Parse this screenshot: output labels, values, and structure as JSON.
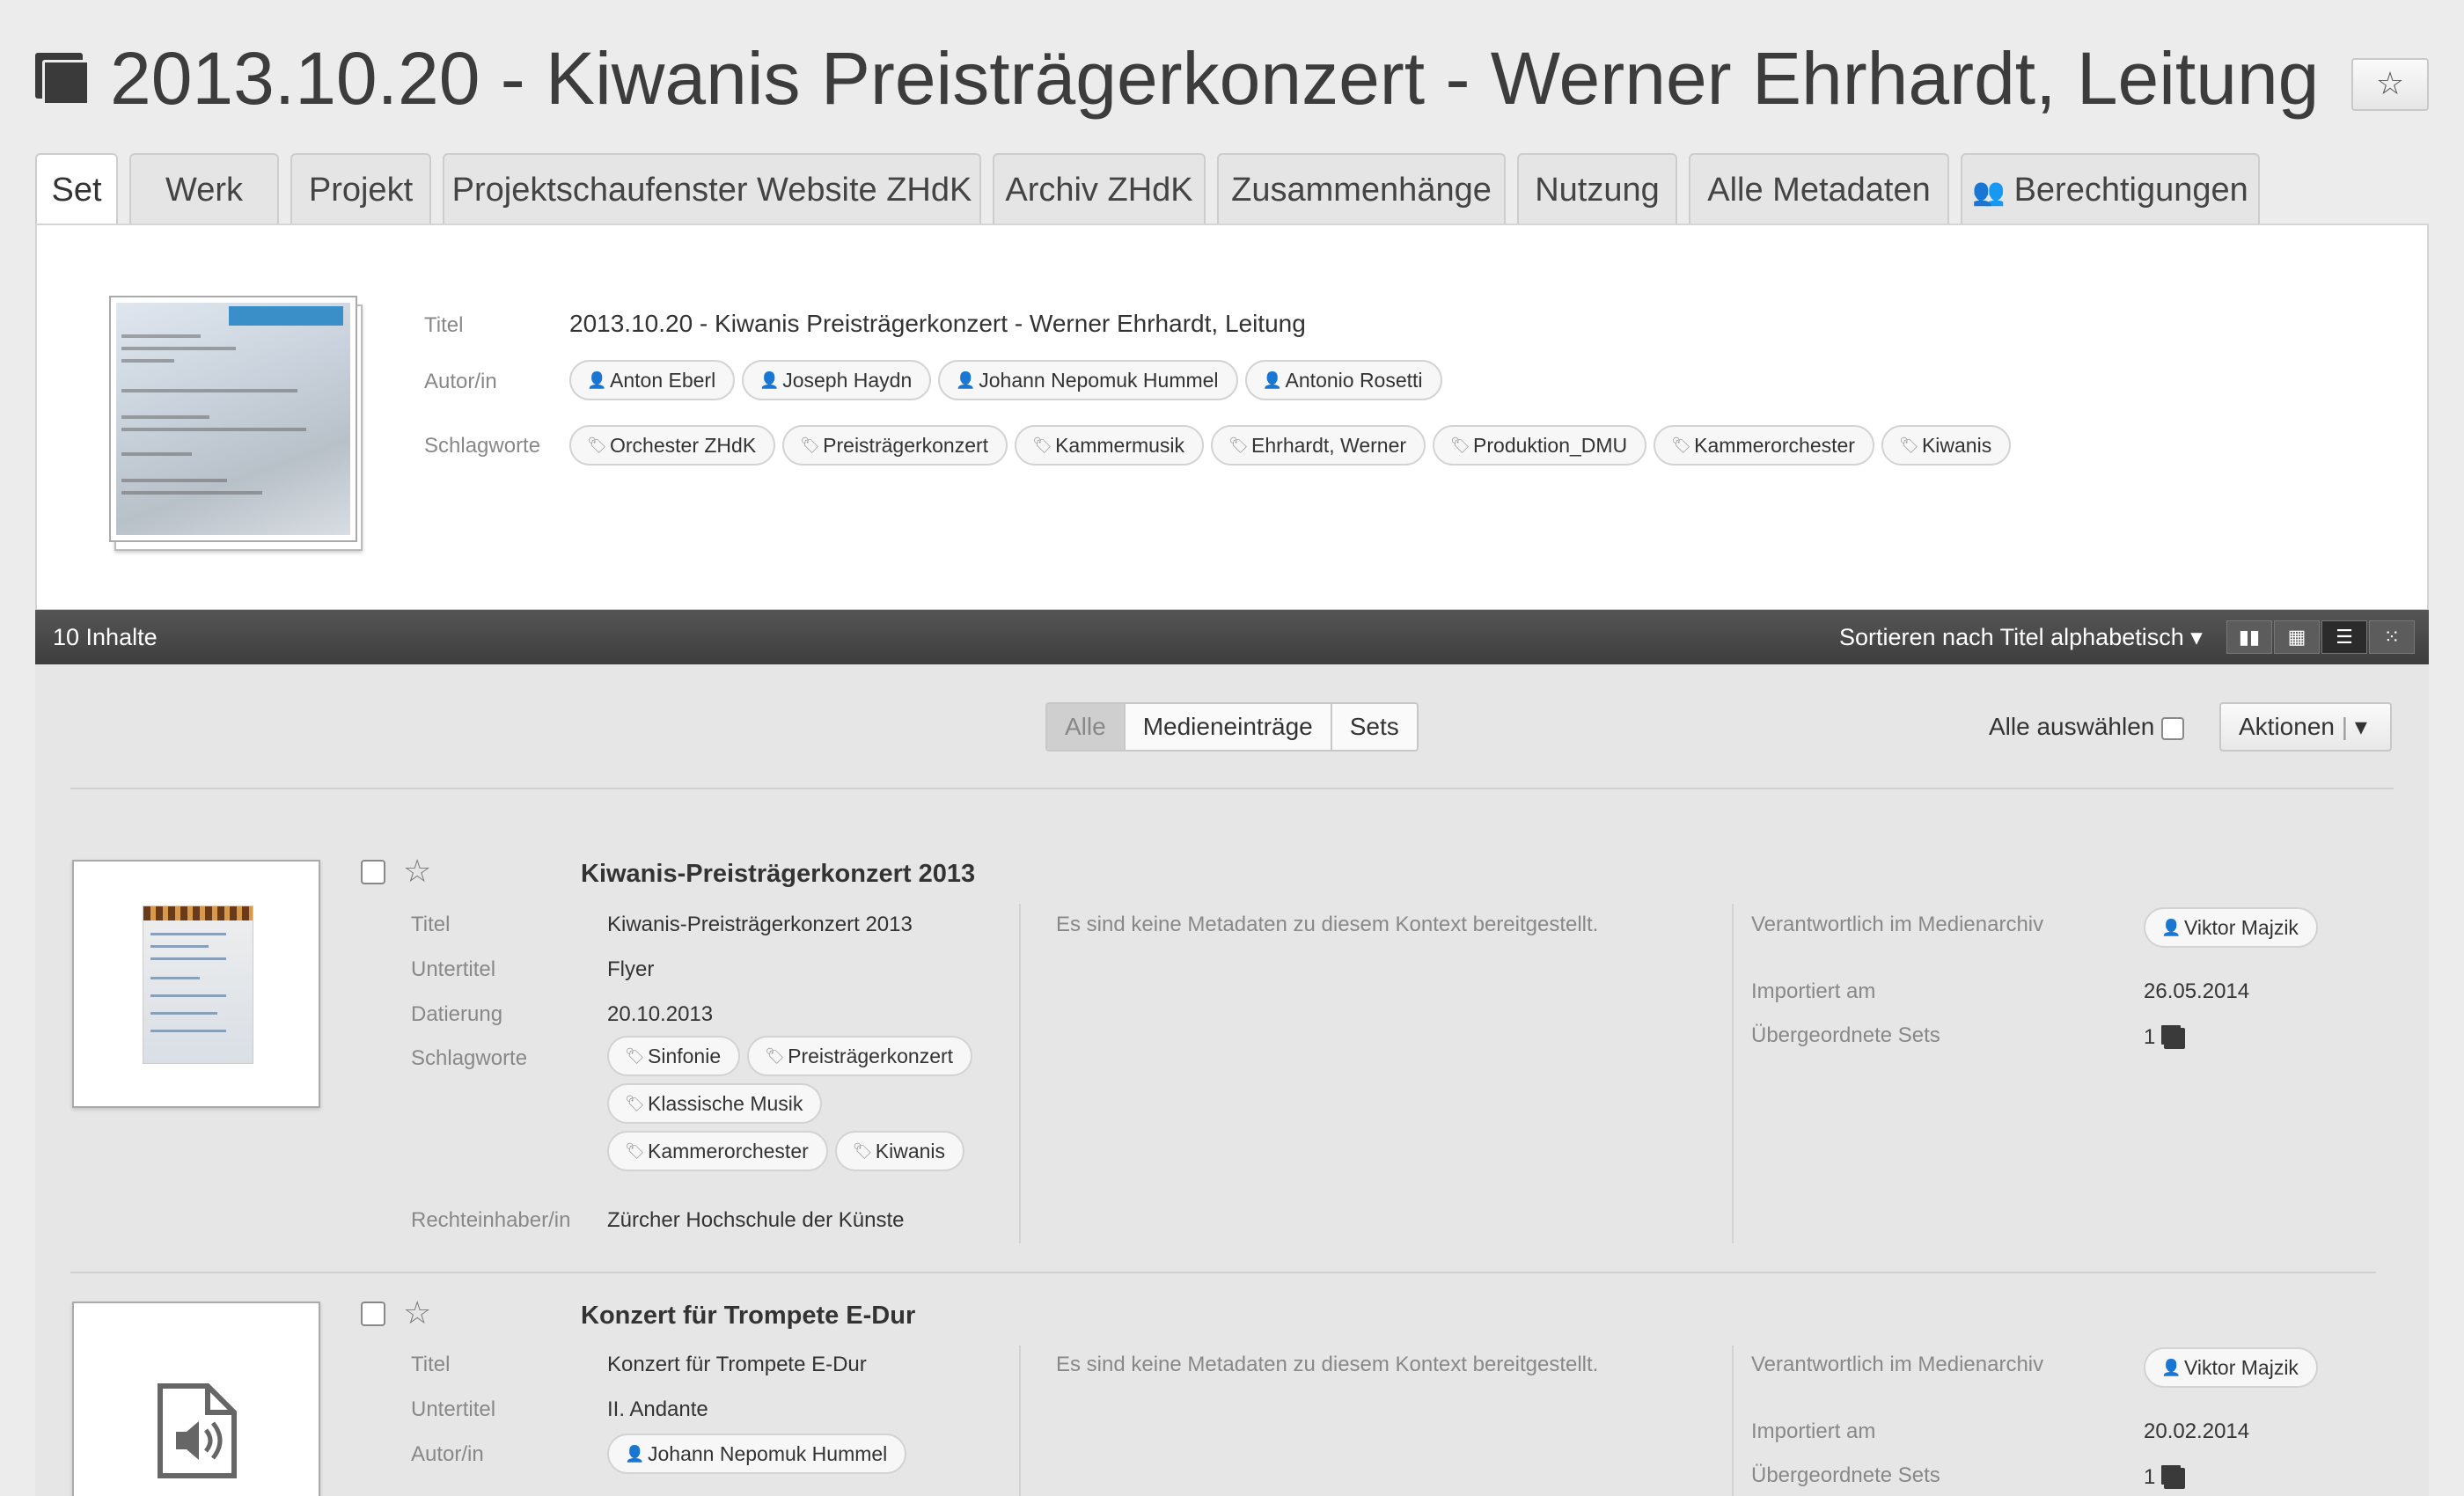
{
  "page": {
    "title": "2013.10.20 - Kiwanis Preisträgerkonzert - Werner Ehrhardt, Leitung"
  },
  "tabs": [
    {
      "label": "Set"
    },
    {
      "label": "Werk"
    },
    {
      "label": "Projekt"
    },
    {
      "label": "Projektschaufenster Website ZHdK"
    },
    {
      "label": "Archiv ZHdK"
    },
    {
      "label": "Zusammenhänge"
    },
    {
      "label": "Nutzung"
    },
    {
      "label": "Alle Metadaten"
    },
    {
      "label": "Berechtigungen",
      "icon": "users-icon"
    }
  ],
  "set_meta": {
    "title_label": "Titel",
    "title_value": "2013.10.20 - Kiwanis Preisträgerkonzert - Werner Ehrhardt, Leitung",
    "authors_label": "Autor/in",
    "authors": [
      "Anton Eberl",
      "Joseph Haydn",
      "Johann Nepomuk Hummel",
      "Antonio Rosetti"
    ],
    "keywords_label": "Schlagworte",
    "keywords": [
      "Orchester ZHdK",
      "Preisträgerkonzert",
      "Kammermusik",
      "Ehrhardt, Werner",
      "Produktion_DMU",
      "Kammerorchester",
      "Kiwanis"
    ]
  },
  "toolbar": {
    "count": "10 Inhalte",
    "sort": "Sortieren nach Titel alphabetisch ▾",
    "views": [
      "miniature-view-icon",
      "grid-view-icon",
      "list-view-icon",
      "tiles-view-icon"
    ],
    "active_view": "list-view-icon"
  },
  "filter": {
    "all": "Alle",
    "media": "Medieneinträge",
    "sets": "Sets",
    "active": "Alle"
  },
  "select_all": "Alle auswählen",
  "actions": "Aktionen",
  "items": [
    {
      "title": "Kiwanis-Preisträgerkonzert 2013",
      "fields": [
        {
          "label": "Titel",
          "value": "Kiwanis-Preisträgerkonzert 2013"
        },
        {
          "label": "Untertitel",
          "value": "Flyer"
        },
        {
          "label": "Datierung",
          "value": "20.10.2013"
        },
        {
          "label": "Schlagworte"
        },
        {
          "label": "Rechteinhaber/in",
          "value": "Zürcher Hochschule der Künste"
        }
      ],
      "keywords": [
        "Sinfonie",
        "Preisträgerkonzert",
        "Klassische Musik",
        "Kammerorchester",
        "Kiwanis"
      ],
      "no_meta": "Es sind keine Metadaten zu diesem Kontext bereitgestellt.",
      "responsible_label": "Verantwortlich im Medienarchiv",
      "responsible": "Viktor Majzik",
      "imported_label": "Importiert am",
      "imported": "26.05.2014",
      "parents_label": "Übergeordnete Sets",
      "parents": "1"
    },
    {
      "title": "Konzert für Trompete E-Dur",
      "fields": [
        {
          "label": "Titel",
          "value": "Konzert für Trompete E-Dur"
        },
        {
          "label": "Untertitel",
          "value": "II. Andante"
        },
        {
          "label": "Autor/in"
        }
      ],
      "authors": [
        "Johann Nepomuk Hummel"
      ],
      "no_meta": "Es sind keine Metadaten zu diesem Kontext bereitgestellt.",
      "responsible_label": "Verantwortlich im Medienarchiv",
      "responsible": "Viktor Majzik",
      "imported_label": "Importiert am",
      "imported": "20.02.2014",
      "parents_label": "Übergeordnete Sets",
      "parents": "1"
    }
  ]
}
